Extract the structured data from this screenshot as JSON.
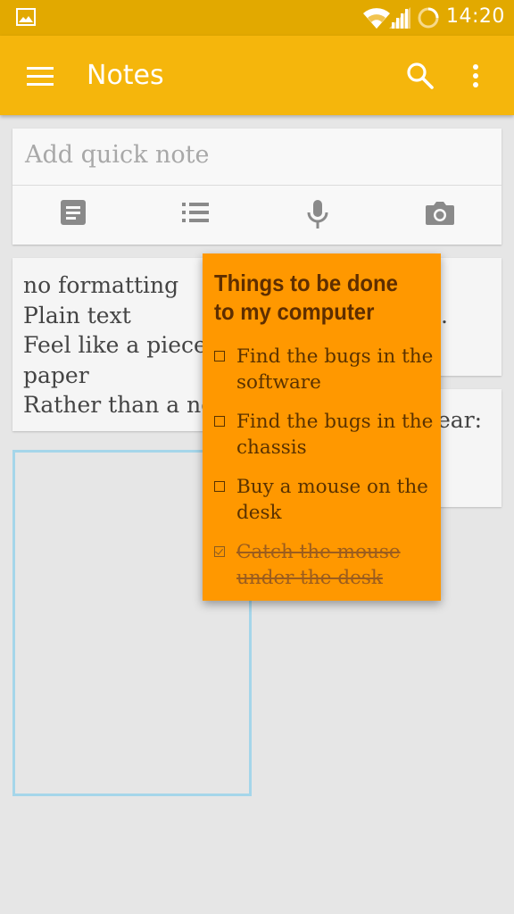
{
  "status_bar": {
    "time": "14:20",
    "icons": [
      "gallery-icon",
      "wifi-icon",
      "signal-icon",
      "loading-icon"
    ]
  },
  "app_bar": {
    "title": "Notes",
    "icons": [
      "menu-icon",
      "search-icon",
      "more-vert-icon"
    ]
  },
  "quick_note": {
    "placeholder": "Add quick note",
    "tools": [
      "text-note-icon",
      "list-note-icon",
      "mic-icon",
      "camera-icon"
    ]
  },
  "notes": [
    {
      "text_lines": [
        "no formatting",
        "Plain text",
        "Feel like a piece",
        "paper",
        "Rather than a no"
      ]
    },
    {
      "text": "."
    },
    {
      "text": "ear:"
    }
  ],
  "dragged_note": {
    "title": "Things to be done to my computer",
    "items": [
      {
        "label": "Find the bugs in the software",
        "checked": false
      },
      {
        "label": "Find the bugs in the chassis",
        "checked": false
      },
      {
        "label": "Buy a mouse on the desk",
        "checked": false
      },
      {
        "label": "Catch the mouse under the desk",
        "checked": true
      }
    ]
  },
  "colors": {
    "status_bar": "#e2a900",
    "app_bar": "#f5b60c",
    "dragged_note_bg": "#ff9800",
    "drop_target_border": "#a5d6ea",
    "background": "#e6e6e6"
  }
}
